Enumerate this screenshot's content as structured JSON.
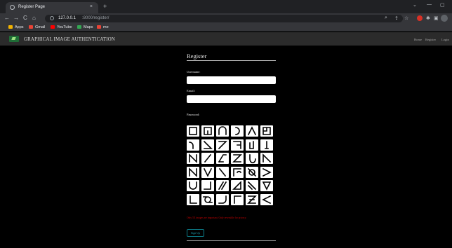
{
  "browser": {
    "tab_title": "Register Page",
    "tab_close": "×",
    "new_tab": "+",
    "url_host": "127.0.0.1",
    "url_path": ":8000/register/",
    "nav": {
      "back": "←",
      "forward": "→",
      "reload": "C",
      "home": "⌂"
    },
    "toolbar_icons": [
      "search-icon",
      "share-icon",
      "star-icon",
      "extension-icon",
      "puzzle-icon",
      "sidebar-icon"
    ],
    "window_controls": [
      "minimize-icon",
      "maximize-icon"
    ],
    "bookmarks": [
      {
        "label": "Apps",
        "color": "#f4b400"
      },
      {
        "label": "Gmail",
        "color": "#ea4335"
      },
      {
        "label": "YouTube",
        "color": "#ff0000"
      },
      {
        "label": "Maps",
        "color": "#34a853"
      },
      {
        "label": "me",
        "color": "#ea4335"
      }
    ]
  },
  "navbar": {
    "brand": "GRAPHICAL IMAGE AUTHENTICATION",
    "links": [
      "Home",
      "Register",
      "Login"
    ]
  },
  "form": {
    "title": "Register",
    "username_label": "Username:",
    "username_value": "",
    "email_label": "Email:",
    "email_value": "",
    "password_label": "Password:",
    "note": "Only 5X images are important. Only reversible for privacy.",
    "submit_label": "Sign Up",
    "accent_color": "#0c7a86",
    "note_color": "#c00000"
  },
  "password_grid": {
    "rows": 6,
    "cols": 6,
    "tiles": [
      "square-icon",
      "corner-bracket-icon",
      "arc-icon",
      "half-circle-icon",
      "caret-icon",
      "box-corner-icon",
      "hook-icon",
      "diagonal-wedge-icon",
      "slash-z-icon",
      "step-icon",
      "bracket-line-icon",
      "vertical-line-icon",
      "n-shape-icon",
      "slash-icon",
      "skew-bar-icon",
      "z-shape-icon",
      "crescent-icon",
      "n-diagonal-icon",
      "zigzag-icon",
      "v-shape-icon",
      "backslash-icon",
      "open-square-icon",
      "circle-outline-icon",
      "greater-than-icon",
      "u-curve-icon",
      "j-shape-icon",
      "diagonal-lines-icon",
      "triangle-corner-icon",
      "diagonal-slash-icon",
      "chevron-down-icon",
      "l-shape-icon",
      "ring-icon",
      "curved-corner-icon",
      "gamma-icon",
      "z-hatched-icon",
      "less-than-icon"
    ]
  }
}
